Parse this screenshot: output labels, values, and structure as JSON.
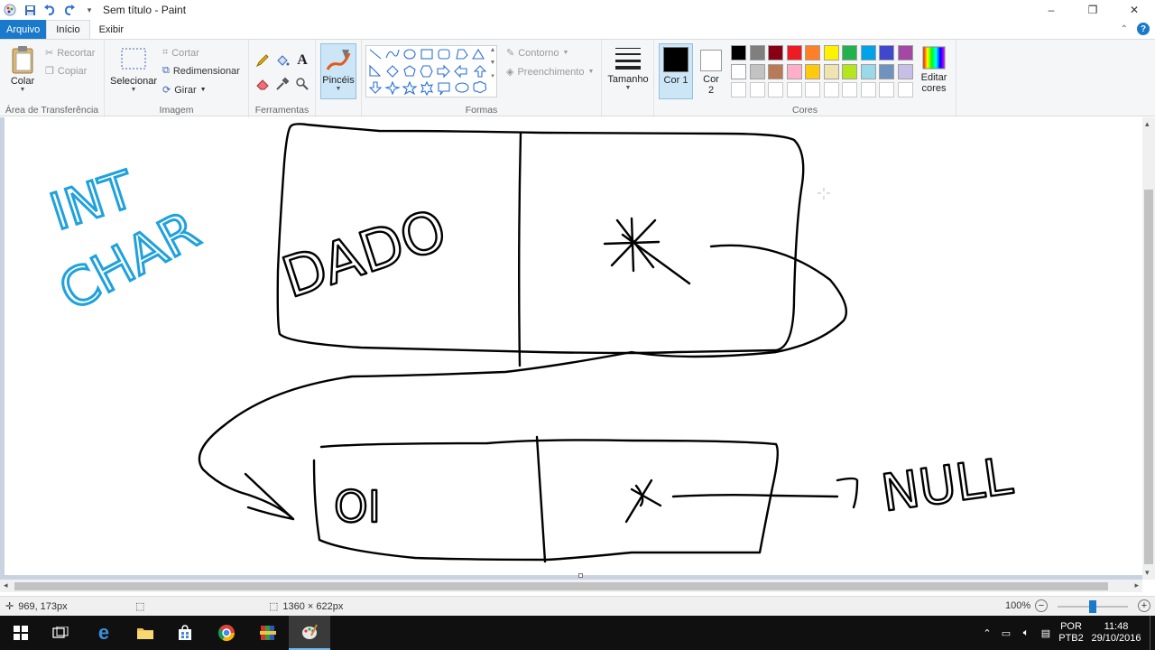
{
  "window": {
    "title": "Sem título - Paint",
    "controls": {
      "minimize": "–",
      "restore": "❐",
      "close": "✕"
    }
  },
  "tabs": [
    {
      "label": "Arquivo"
    },
    {
      "label": "Início"
    },
    {
      "label": "Exibir"
    }
  ],
  "help_label": "?",
  "ribbon": {
    "clipboard": {
      "label": "Área de Transferência",
      "paste": "Colar",
      "cut": "Recortar",
      "copy": "Copiar"
    },
    "image": {
      "label": "Imagem",
      "select": "Selecionar",
      "crop": "Cortar",
      "resize": "Redimensionar",
      "rotate": "Girar"
    },
    "tools": {
      "label": "Ferramentas",
      "text_tool": "A"
    },
    "brushes": {
      "label": "Pincéis"
    },
    "shapes": {
      "label": "Formas",
      "outline": "Contorno",
      "fill": "Preenchimento"
    },
    "size": {
      "label": "Tamanho"
    },
    "colors": {
      "label": "Cores",
      "color1": "Cor 1",
      "color2": "Cor 2",
      "color1_value": "#000000",
      "color2_value": "#ffffff",
      "edit": "Editar cores",
      "palette_row1": [
        "#000000",
        "#7f7f7f",
        "#880015",
        "#ed1c24",
        "#ff7f27",
        "#fff200",
        "#22b14c",
        "#00a2e8",
        "#3f48cc",
        "#a349a4"
      ],
      "palette_row2": [
        "#ffffff",
        "#c3c3c3",
        "#b97a57",
        "#ffaec9",
        "#ffc90e",
        "#efe4b0",
        "#b5e61d",
        "#99d9ea",
        "#7092be",
        "#c8bfe7"
      ]
    }
  },
  "canvas": {
    "handwriting": {
      "blue_1": "INT",
      "blue_2": "CHAR",
      "box1_label": "DADO",
      "box2_label": "OI",
      "null_label": "NULL"
    }
  },
  "status": {
    "cursor_pos": "969, 173px",
    "image_size": "1360 × 622px",
    "zoom": "100%"
  },
  "taskbar": {
    "lang_1": "POR",
    "lang_2": "PTB2",
    "time": "11:48",
    "date": "29/10/2016"
  }
}
